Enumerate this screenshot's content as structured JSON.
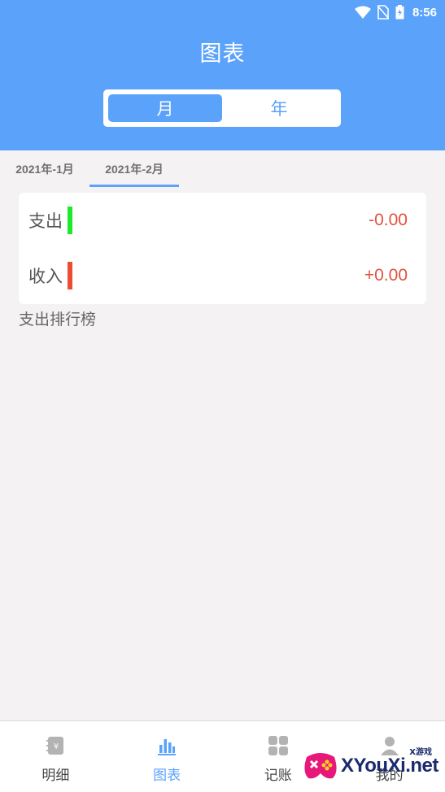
{
  "status_bar": {
    "time": "8:56"
  },
  "header": {
    "title": "图表"
  },
  "period_toggle": {
    "options": [
      "月",
      "年"
    ],
    "selected": "月"
  },
  "month_tabs": [
    "2021年-1月",
    "2021年-2月"
  ],
  "selected_month": "2021年-2月",
  "summary": {
    "expense": {
      "label": "支出",
      "value": "-0.00",
      "bar_color": "#1ee82a"
    },
    "income": {
      "label": "收入",
      "value": "+0.00",
      "bar_color": "#ee4b35"
    }
  },
  "ranking": {
    "title": "支出排行榜"
  },
  "bottom_nav": {
    "items": [
      {
        "label": "明细",
        "icon": "notebook-yen-icon"
      },
      {
        "label": "图表",
        "icon": "bar-chart-icon"
      },
      {
        "label": "记账",
        "icon": "grid-icon"
      },
      {
        "label": "我的",
        "icon": "user-icon"
      }
    ],
    "active": "图表"
  },
  "watermark": {
    "text": "XYouXi.net",
    "small": "X游戏"
  },
  "colors": {
    "accent": "#5ba2fb",
    "negative": "#e2513f",
    "background": "#f4f2f2"
  }
}
